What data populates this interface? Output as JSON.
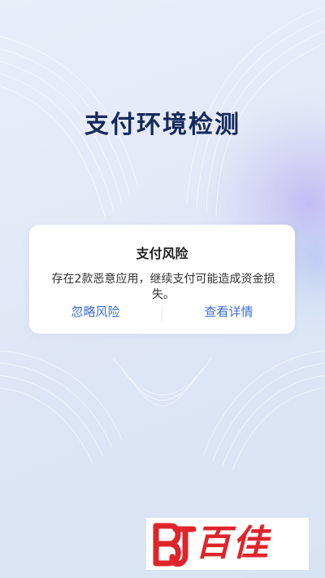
{
  "screen": {
    "title": "支付环境检测"
  },
  "dialog": {
    "title": "支付风险",
    "message": "存在2款恶意应用，继续支付可能造成资金损失。",
    "ignore_label": "忽略风险",
    "details_label": "查看详情"
  },
  "watermark": {
    "logo_letters": "BJ",
    "brand_text": "百佳"
  },
  "colors": {
    "title": "#152a5a",
    "action": "#3a6fd8",
    "watermark": "#e0242b"
  }
}
